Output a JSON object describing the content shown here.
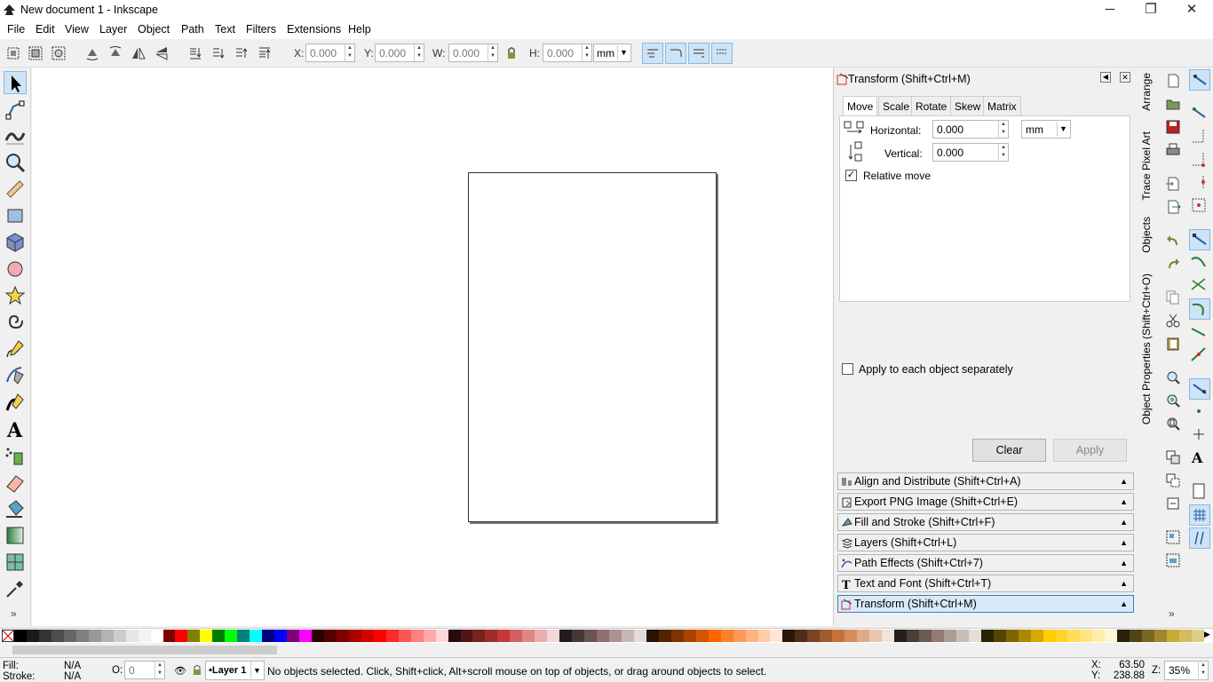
{
  "window": {
    "title": "New document 1 - Inkscape",
    "minimize": "─",
    "maximize": "❐",
    "close": "✕"
  },
  "menu": [
    "File",
    "Edit",
    "View",
    "Layer",
    "Object",
    "Path",
    "Text",
    "Filters",
    "Extensions",
    "Help"
  ],
  "toolbar": {
    "x_label": "X:",
    "x_value": "0.000",
    "y_label": "Y:",
    "y_value": "0.000",
    "w_label": "W:",
    "w_value": "0.000",
    "h_label": "H:",
    "h_value": "0.000",
    "unit": "mm"
  },
  "transform_dialog": {
    "title": "Transform (Shift+Ctrl+M)",
    "tabs": [
      "Move",
      "Scale",
      "Rotate",
      "Skew",
      "Matrix"
    ],
    "active_tab": "Move",
    "horizontal_label": "Horizontal:",
    "horizontal_value": "0.000",
    "vertical_label": "Vertical:",
    "vertical_value": "0.000",
    "unit": "mm",
    "relative_move": "Relative move",
    "relative_checked": "✓",
    "apply_each": "Apply to each object separately",
    "clear": "Clear",
    "apply": "Apply"
  },
  "docked_dialogs": [
    "Align and Distribute (Shift+Ctrl+A)",
    "Export PNG Image (Shift+Ctrl+E)",
    "Fill and Stroke (Shift+Ctrl+F)",
    "Layers (Shift+Ctrl+L)",
    "Path Effects  (Shift+Ctrl+7)",
    "Text and Font (Shift+Ctrl+T)",
    "Transform (Shift+Ctrl+M)"
  ],
  "vertical_tabs": [
    "Arrange",
    "Trace Pixel Art",
    "Objects",
    "Object Properties (Shift+Ctrl+O)"
  ],
  "palette_colors": [
    "#000000",
    "#1a1a1a",
    "#333333",
    "#4d4d4d",
    "#666666",
    "#808080",
    "#999999",
    "#b3b3b3",
    "#cccccc",
    "#e6e6e6",
    "#f2f2f2",
    "#ffffff",
    "#800000",
    "#ff0000",
    "#808000",
    "#ffff00",
    "#008000",
    "#00ff00",
    "#008080",
    "#00ffff",
    "#000080",
    "#0000ff",
    "#800080",
    "#ff00ff",
    "#2b0000",
    "#550000",
    "#800000",
    "#aa0000",
    "#d40000",
    "#ff0000",
    "#ff2a2a",
    "#ff5555",
    "#ff8080",
    "#ffaaaa",
    "#ffd5d5",
    "#280b0b",
    "#501616",
    "#782121",
    "#a02c2c",
    "#c83737",
    "#d35f5f",
    "#de8787",
    "#e9afaf",
    "#f4d7d7",
    "#241c1c",
    "#483737",
    "#6c5353",
    "#916f6f",
    "#ac9393",
    "#c8b7b7",
    "#e3dbdb",
    "#2b1100",
    "#552200",
    "#803300",
    "#aa4400",
    "#d45500",
    "#ff6600",
    "#ff7f2a",
    "#ff9955",
    "#ffb380",
    "#ffccaa",
    "#ffe6d5",
    "#28170b",
    "#502d16",
    "#784421",
    "#a05a2c",
    "#c87137",
    "#d38d5f",
    "#deaa87",
    "#e9c6af",
    "#f4e3d7",
    "#241f1c",
    "#483e37",
    "#6c5d53",
    "#917c6f",
    "#ac9d93",
    "#c8beb7",
    "#e3dedb",
    "#2b2200",
    "#554400",
    "#806600",
    "#aa8800",
    "#d4aa00",
    "#ffcc00",
    "#ffd42a",
    "#ffdd55",
    "#ffe680",
    "#ffeeaa",
    "#fff6d5",
    "#28220b",
    "#504416",
    "#786721",
    "#a0892c",
    "#c8ab37",
    "#d3bc5f",
    "#decd87"
  ],
  "status": {
    "fill_label": "Fill:",
    "fill_value": "N/A",
    "stroke_label": "Stroke:",
    "stroke_value": "N/A",
    "opacity_label": "O:",
    "opacity_value": "0",
    "layer": "•Layer 1",
    "message": "No objects selected. Click, Shift+click, Alt+scroll mouse on top of objects, or drag around objects to select.",
    "x_label": "X:",
    "x_value": "63.50",
    "y_label": "Y:",
    "y_value": "238.88",
    "zoom_label": "Z:",
    "zoom_value": "35%"
  },
  "icons": {
    "app": "inkscape-logo-icon",
    "more_tools": "»"
  }
}
